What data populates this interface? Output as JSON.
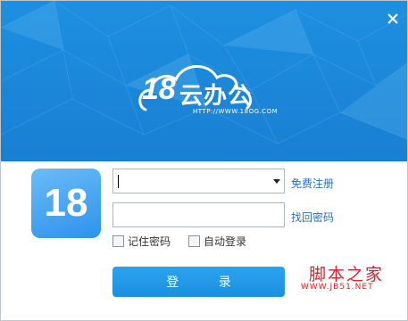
{
  "window": {
    "close_icon": "close-icon"
  },
  "brand": {
    "logo_number": "18",
    "name": "云办公",
    "url": "HTTP://WWW.18OG.COM"
  },
  "app_icon": {
    "text": "18"
  },
  "login_form": {
    "account_value": "",
    "password_value": "",
    "register_link": "免费注册",
    "recover_link": "找回密码",
    "remember_password_label": "记住密码",
    "auto_login_label": "自动登录",
    "login_button": "登 录"
  },
  "watermark": {
    "name": "脚本之家",
    "url": "WWW.JB51.NET"
  },
  "colors": {
    "banner": "#1e8fe0",
    "button": "#2aa3ee",
    "link": "#2a6fc0",
    "watermark": "#d8232a"
  }
}
